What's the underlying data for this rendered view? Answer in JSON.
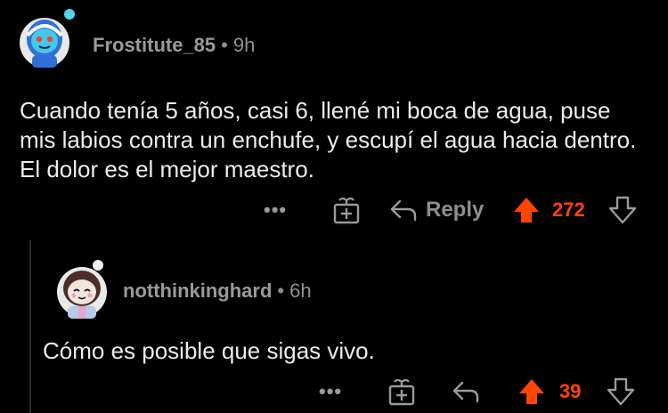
{
  "comments": [
    {
      "username": "Frostitute_85",
      "separator": "•",
      "age": "9h",
      "text": "Cuando tenía 5 años, casi 6, llené mi boca de agua, puse mis labios contra un enchufe, y escupí el agua hacia dentro. El dolor es el mejor maestro.",
      "more": "•••",
      "reply_label": "Reply",
      "score": "272",
      "icons": {
        "avatar": "snoo-avatar-blue-hood",
        "award": "gift-icon",
        "reply": "reply-arrow-icon",
        "upvote": "upvote-arrow-icon",
        "downvote": "downvote-arrow-icon"
      }
    },
    {
      "username": "notthinkinghard",
      "separator": "•",
      "age": "6h",
      "text": "Cómo es posible que sigas vivo.",
      "more": "•••",
      "score": "39",
      "icons": {
        "avatar": "snoo-avatar-brown-hair",
        "award": "gift-icon",
        "reply": "reply-arrow-icon",
        "upvote": "upvote-arrow-icon",
        "downvote": "downvote-arrow-icon"
      }
    }
  ],
  "colors": {
    "background": "#000000",
    "upvoted": "#ff4500",
    "muted": "#8f8f8f",
    "text": "#ececec"
  }
}
